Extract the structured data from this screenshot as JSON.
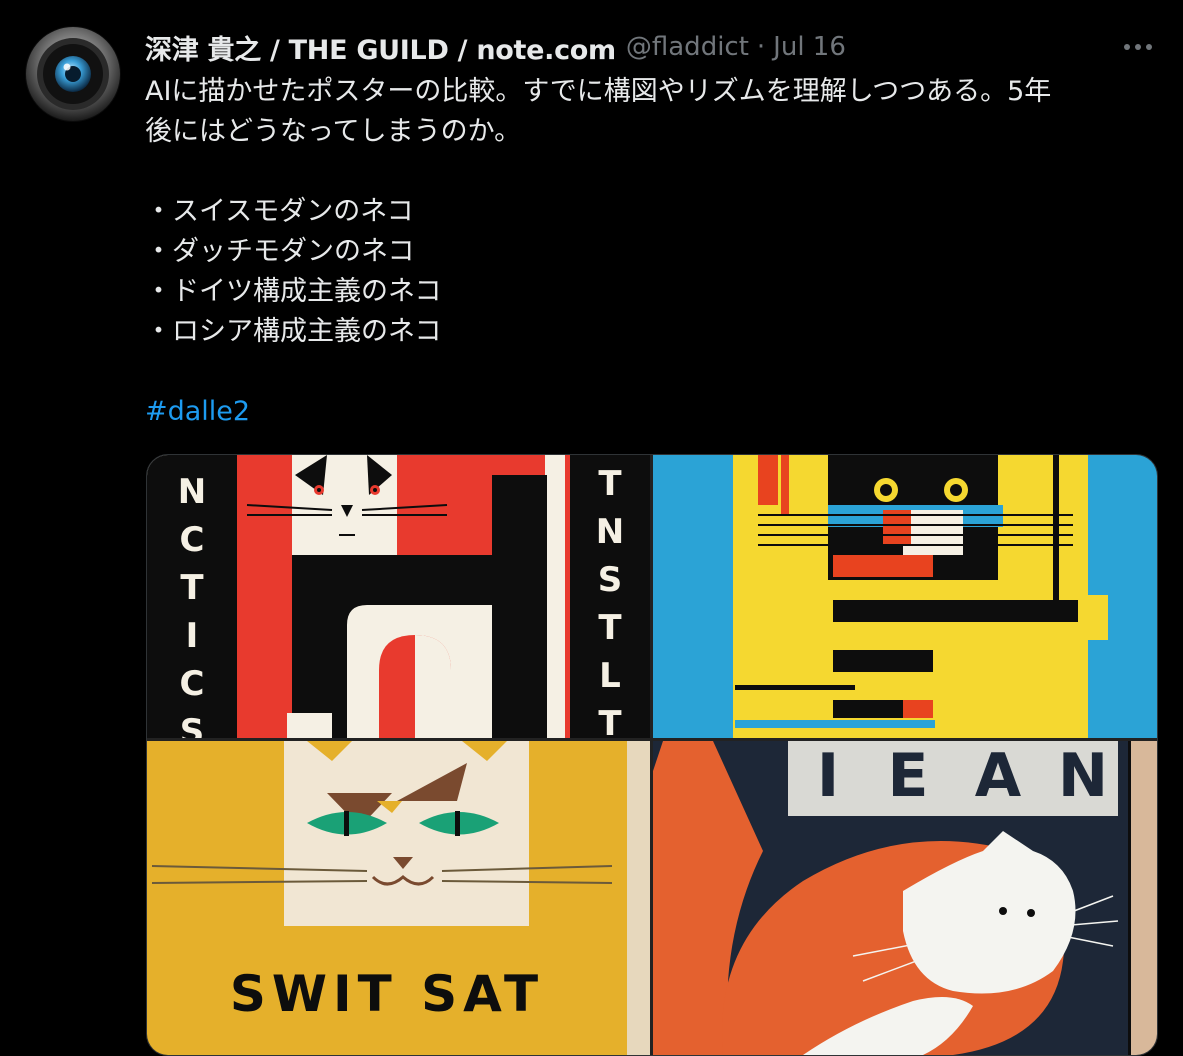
{
  "tweet": {
    "author_name": "深津 貴之 / THE GUILD / note.com",
    "author_handle": "@fladdict",
    "separator": "·",
    "timestamp": "Jul 16",
    "more_label": "•••",
    "text_lines": [
      "AIに描かせたポスターの比較。すでに構図やリズムを理解しつつある。5年",
      "後にはどうなってしまうのか。"
    ],
    "bullets": [
      "・スイスモダンのネコ",
      "・ダッチモダンのネコ",
      "・ドイツ構成主義のネコ",
      "・ロシア構成主義のネコ"
    ],
    "hashtag": "#dalle2"
  },
  "media": {
    "images": [
      {
        "name": "poster-swiss-modern",
        "letters_left": [
          "N",
          "C",
          "T",
          "I",
          "C",
          "S"
        ],
        "letters_right": [
          "T",
          "N",
          "S",
          "T",
          "L",
          "T"
        ],
        "colors": {
          "red": "#e83a2e",
          "black": "#0d0d0d",
          "cream": "#f5f0e4"
        }
      },
      {
        "name": "poster-dutch-modern",
        "colors": {
          "yellow": "#f5d830",
          "blue": "#2ba3d6",
          "red": "#e8431f",
          "black": "#0d0d0d"
        }
      },
      {
        "name": "poster-german-constructivism",
        "caption": "SWIT SAT",
        "colors": {
          "mustard": "#e5b02b",
          "cream": "#f1e6d3",
          "green": "#1aa176",
          "brown": "#7a4a2f"
        }
      },
      {
        "name": "poster-russian-constructivism",
        "letters": [
          "I",
          "E",
          "A",
          "N"
        ],
        "colors": {
          "navy": "#1d2737",
          "orange": "#e4612f",
          "white": "#f4f4f0",
          "tan": "#d8b89a"
        }
      }
    ]
  }
}
